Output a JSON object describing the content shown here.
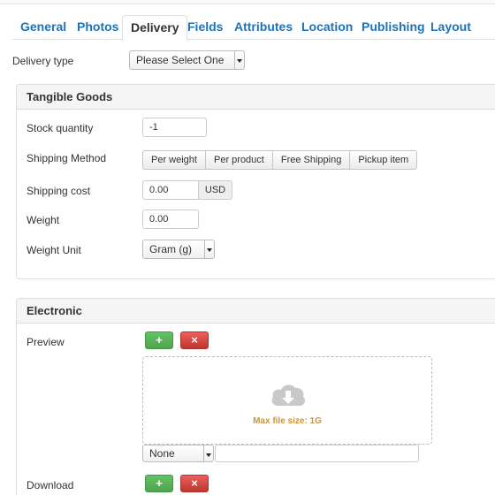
{
  "tabs": [
    {
      "label": "General"
    },
    {
      "label": "Photos"
    },
    {
      "label": "Delivery"
    },
    {
      "label": "Fields"
    },
    {
      "label": "Attributes"
    },
    {
      "label": "Location"
    },
    {
      "label": "Publishing"
    },
    {
      "label": "Layout"
    }
  ],
  "active_tab": "Delivery",
  "delivery_type": {
    "label": "Delivery type",
    "selected": "Please Select One"
  },
  "tangible": {
    "title": "Tangible Goods",
    "stock": {
      "label": "Stock quantity",
      "value": "-1"
    },
    "shipping_method": {
      "label": "Shipping Method",
      "options": [
        "Per weight",
        "Per product",
        "Free Shipping",
        "Pickup item"
      ]
    },
    "shipping_cost": {
      "label": "Shipping cost",
      "value": "0.00",
      "currency": "USD"
    },
    "weight": {
      "label": "Weight",
      "value": "0.00"
    },
    "weight_unit": {
      "label": "Weight Unit",
      "selected": "Gram (g)"
    }
  },
  "electronic": {
    "title": "Electronic",
    "preview": {
      "label": "Preview",
      "add_symbol": "+",
      "remove_symbol": "×",
      "max_file_text": "Max file size: 1G",
      "select_value": "None",
      "text_value": ""
    },
    "download": {
      "label": "Download",
      "add_symbol": "+",
      "remove_symbol": "×"
    }
  },
  "colors": {
    "link": "#1f73b5",
    "green": "#5bb75b",
    "red": "#da4f49",
    "upload_text": "#c8963e"
  },
  "icons": [
    "cloud-download-icon",
    "select-arrow-icon"
  ]
}
